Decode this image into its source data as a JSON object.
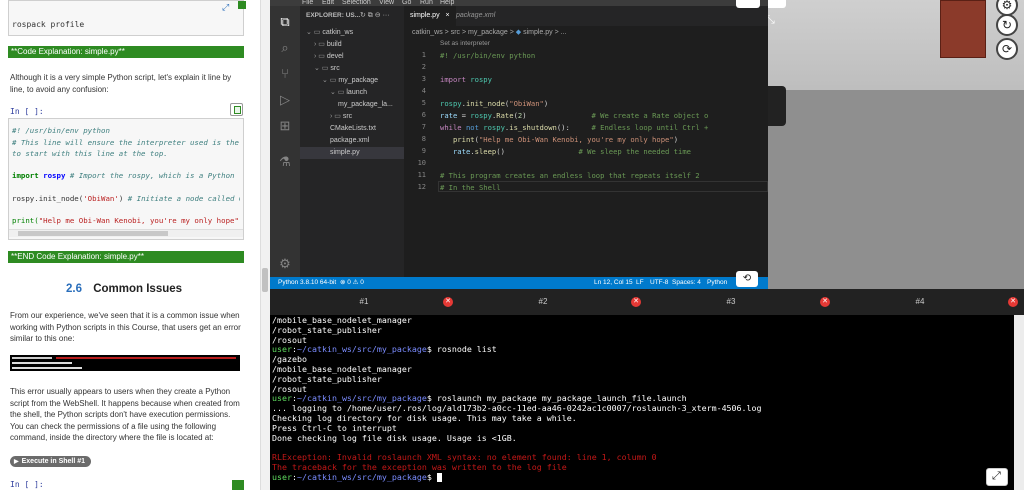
{
  "notebook": {
    "top_code": "rospack profile",
    "code_expl_header": "**Code Explanation: simple.py**",
    "intro": "Although it is a very simple Python script, let's explain it line by line, to avoid any confusion:",
    "cell_prompt": "In [ ]:",
    "code_lines": [
      "#! /usr/bin/env python",
      "# This line will ensure the interpreter used is the fir",
      "to start with this line at the top.",
      "import rospy # Import the rospy, which is a Python libr",
      "rospy.init_node('ObiWan') # Initiate a node called ObiW",
      "print(\"Help me Obi-Wan Kenobi, you're my only hope\") #"
    ],
    "end_header": "**END Code Explanation: simple.py**",
    "section_number": "2.6",
    "section_title": "Common Issues",
    "issue_text": "From our experience, we've seen that it is a common issue when working with Python scripts in this Course, that users get an error similar to this one:",
    "exec_text": "This error usually appears to users when they create a Python script from the WebShell. It happens because when created from the shell, the Python scripts don't have execution permissions. You can check the permissions of a file using the following command, inside the directory where the file is located at:",
    "exec_button": "Execute in Shell #1",
    "bottom_prompt": "In [ ]:"
  },
  "vscode": {
    "menu": [
      "File",
      "Edit",
      "Selection",
      "View",
      "Go",
      "Run",
      "Help"
    ],
    "explorer_title": "EXPLORER: US...",
    "tree": [
      {
        "label": "catkin_ws",
        "indent": 0,
        "type": "folder-open"
      },
      {
        "label": "build",
        "indent": 1,
        "type": "folder"
      },
      {
        "label": "devel",
        "indent": 1,
        "type": "folder"
      },
      {
        "label": "src",
        "indent": 1,
        "type": "folder-open"
      },
      {
        "label": "my_package",
        "indent": 2,
        "type": "folder-open"
      },
      {
        "label": "launch",
        "indent": 3,
        "type": "folder-open"
      },
      {
        "label": "my_package_la...",
        "indent": 4,
        "type": "file"
      },
      {
        "label": "src",
        "indent": 3,
        "type": "folder"
      },
      {
        "label": "CMakeLists.txt",
        "indent": 3,
        "type": "file"
      },
      {
        "label": "package.xml",
        "indent": 3,
        "type": "file"
      },
      {
        "label": "simple.py",
        "indent": 3,
        "type": "file",
        "selected": true
      }
    ],
    "tabs": [
      "simple.py",
      "package.xml"
    ],
    "breadcrumb": [
      "catkin_ws",
      "src",
      "my_package",
      "simple.py",
      "..."
    ],
    "hint": "Set as interpreter",
    "status": [
      "Python 3.8.10 64-bit",
      "⊗ 0 ⚠ 0",
      "Ln 12, Col 15",
      "LF",
      "UTF-8",
      "Spaces: 4",
      "Python"
    ]
  },
  "terminal": {
    "tabs": [
      "#1",
      "#2",
      "#3",
      "#4"
    ],
    "lines": [
      {
        "t": "/mobile_base_nodelet_manager"
      },
      {
        "t": "/robot_state_publisher"
      },
      {
        "t": "/rosout"
      },
      {
        "user": "user",
        "path": "~/catkin_ws/src/my_package",
        "cmd": "$ rosnode list"
      },
      {
        "t": "/gazebo"
      },
      {
        "t": "/mobile_base_nodelet_manager"
      },
      {
        "t": "/robot_state_publisher"
      },
      {
        "t": "/rosout"
      },
      {
        "user": "user",
        "path": "~/catkin_ws/src/my_package",
        "cmd": "$ roslaunch my_package my_package_launch_file.launch"
      },
      {
        "t": "... logging to /home/user/.ros/log/ald173b2-a0cc-11ed-aa46-0242ac1c0007/roslaunch-3_xterm-4506.log"
      },
      {
        "t": "Checking log directory for disk usage. This may take a while."
      },
      {
        "t": "Press Ctrl-C to interrupt"
      },
      {
        "t": "Done checking log file disk usage. Usage is <1GB."
      },
      {
        "t": ""
      },
      {
        "t": "RLException: Invalid roslaunch XML syntax: no element found: line 1, column 0",
        "err": true
      },
      {
        "t": "The traceback for the exception was written to the log file",
        "err": true
      },
      {
        "user": "user",
        "path": "~/catkin_ws/src/my_package",
        "cmd": "$ "
      }
    ]
  }
}
